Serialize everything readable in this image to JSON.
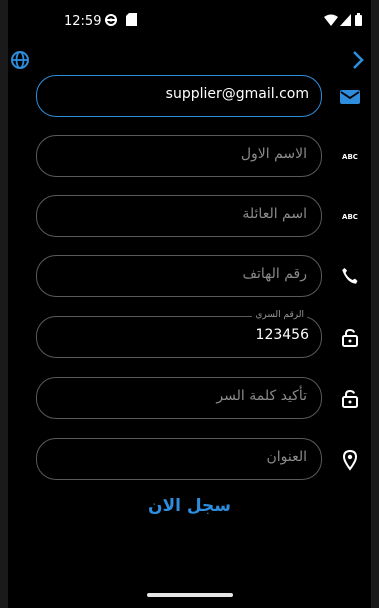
{
  "status_bar": {
    "time": "12:59",
    "left_icons": [
      "settings-icon",
      "sd-card-icon"
    ],
    "right_icons": [
      "wifi-icon",
      "signal-icon",
      "battery-icon"
    ]
  },
  "top_bar": {
    "left_icon": "globe-icon",
    "right_icon": "chevron-right-icon"
  },
  "form": {
    "email": {
      "value": "supplier@gmail.com",
      "icon": "email-icon"
    },
    "first_name": {
      "placeholder": "الاسم الاول",
      "icon": "abc-icon"
    },
    "last_name": {
      "placeholder": "اسم العائلة",
      "icon": "abc-icon"
    },
    "phone": {
      "placeholder": "رقم الهاتف",
      "icon": "phone-icon"
    },
    "password": {
      "label": "الرقم السري",
      "value": "123456",
      "icon": "lock-icon"
    },
    "confirm_password": {
      "placeholder": "تأكيد كلمة السر",
      "icon": "lock-icon"
    },
    "address": {
      "placeholder": "العنوان",
      "icon": "location-icon"
    }
  },
  "submit_label": "سجل الان",
  "colors": {
    "accent": "#2e8ddc",
    "background": "#000000",
    "border": "#5a5a5a"
  }
}
